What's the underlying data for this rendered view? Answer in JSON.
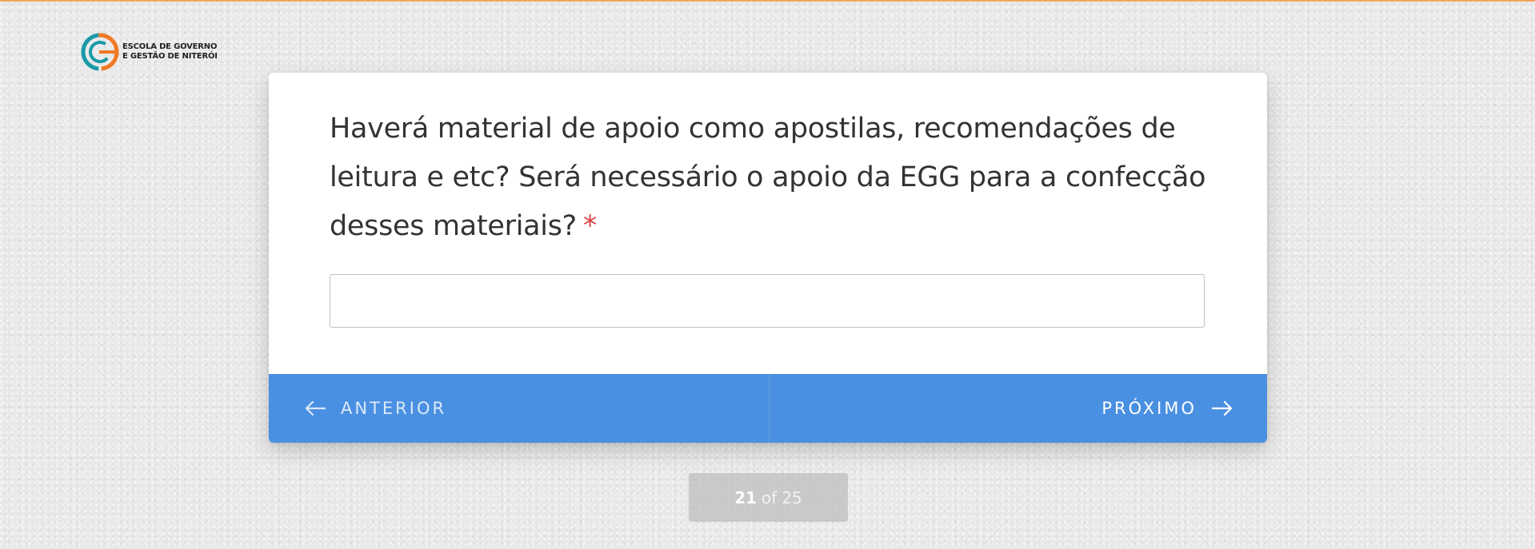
{
  "brand": {
    "name_line1": "ESCOLA DE GOVERNO",
    "name_line2": "E GESTÃO DE NITERÓI",
    "colors": {
      "orange": "#f07a26",
      "teal": "#1a9aa8"
    }
  },
  "question": {
    "text": "Haverá material de apoio como apostilas, recomendações de leitura e etc? Será necessário o apoio da EGG para a confecção desses materiais?",
    "required_marker": "*",
    "answer_value": ""
  },
  "nav": {
    "previous_label": "ANTERIOR",
    "next_label": "PRÓXIMO",
    "previous_icon": "arrow-left-icon",
    "next_icon": "arrow-right-icon",
    "accent_color": "#4a90e2"
  },
  "progress": {
    "current": "21",
    "separator": "of",
    "total": "25"
  }
}
